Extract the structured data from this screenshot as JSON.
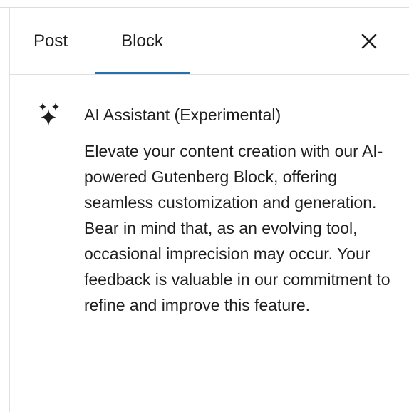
{
  "tabs": {
    "post_label": "Post",
    "block_label": "Block",
    "active": "Block"
  },
  "close_icon": "close-icon",
  "block_info": {
    "icon": "sparkles-icon",
    "title": "AI Assistant (Experimental)",
    "description": "Elevate your content creation with our AI-powered Gutenberg Block, offering seamless customization and generation. Bear in mind that, as an evolving tool, occasional imprecision may occur. Your feedback is valuable in our commitment to refine and improve this feature."
  },
  "colors": {
    "accent": "#2271b1",
    "text": "#1e1e1e",
    "border": "#e0e0e0"
  }
}
